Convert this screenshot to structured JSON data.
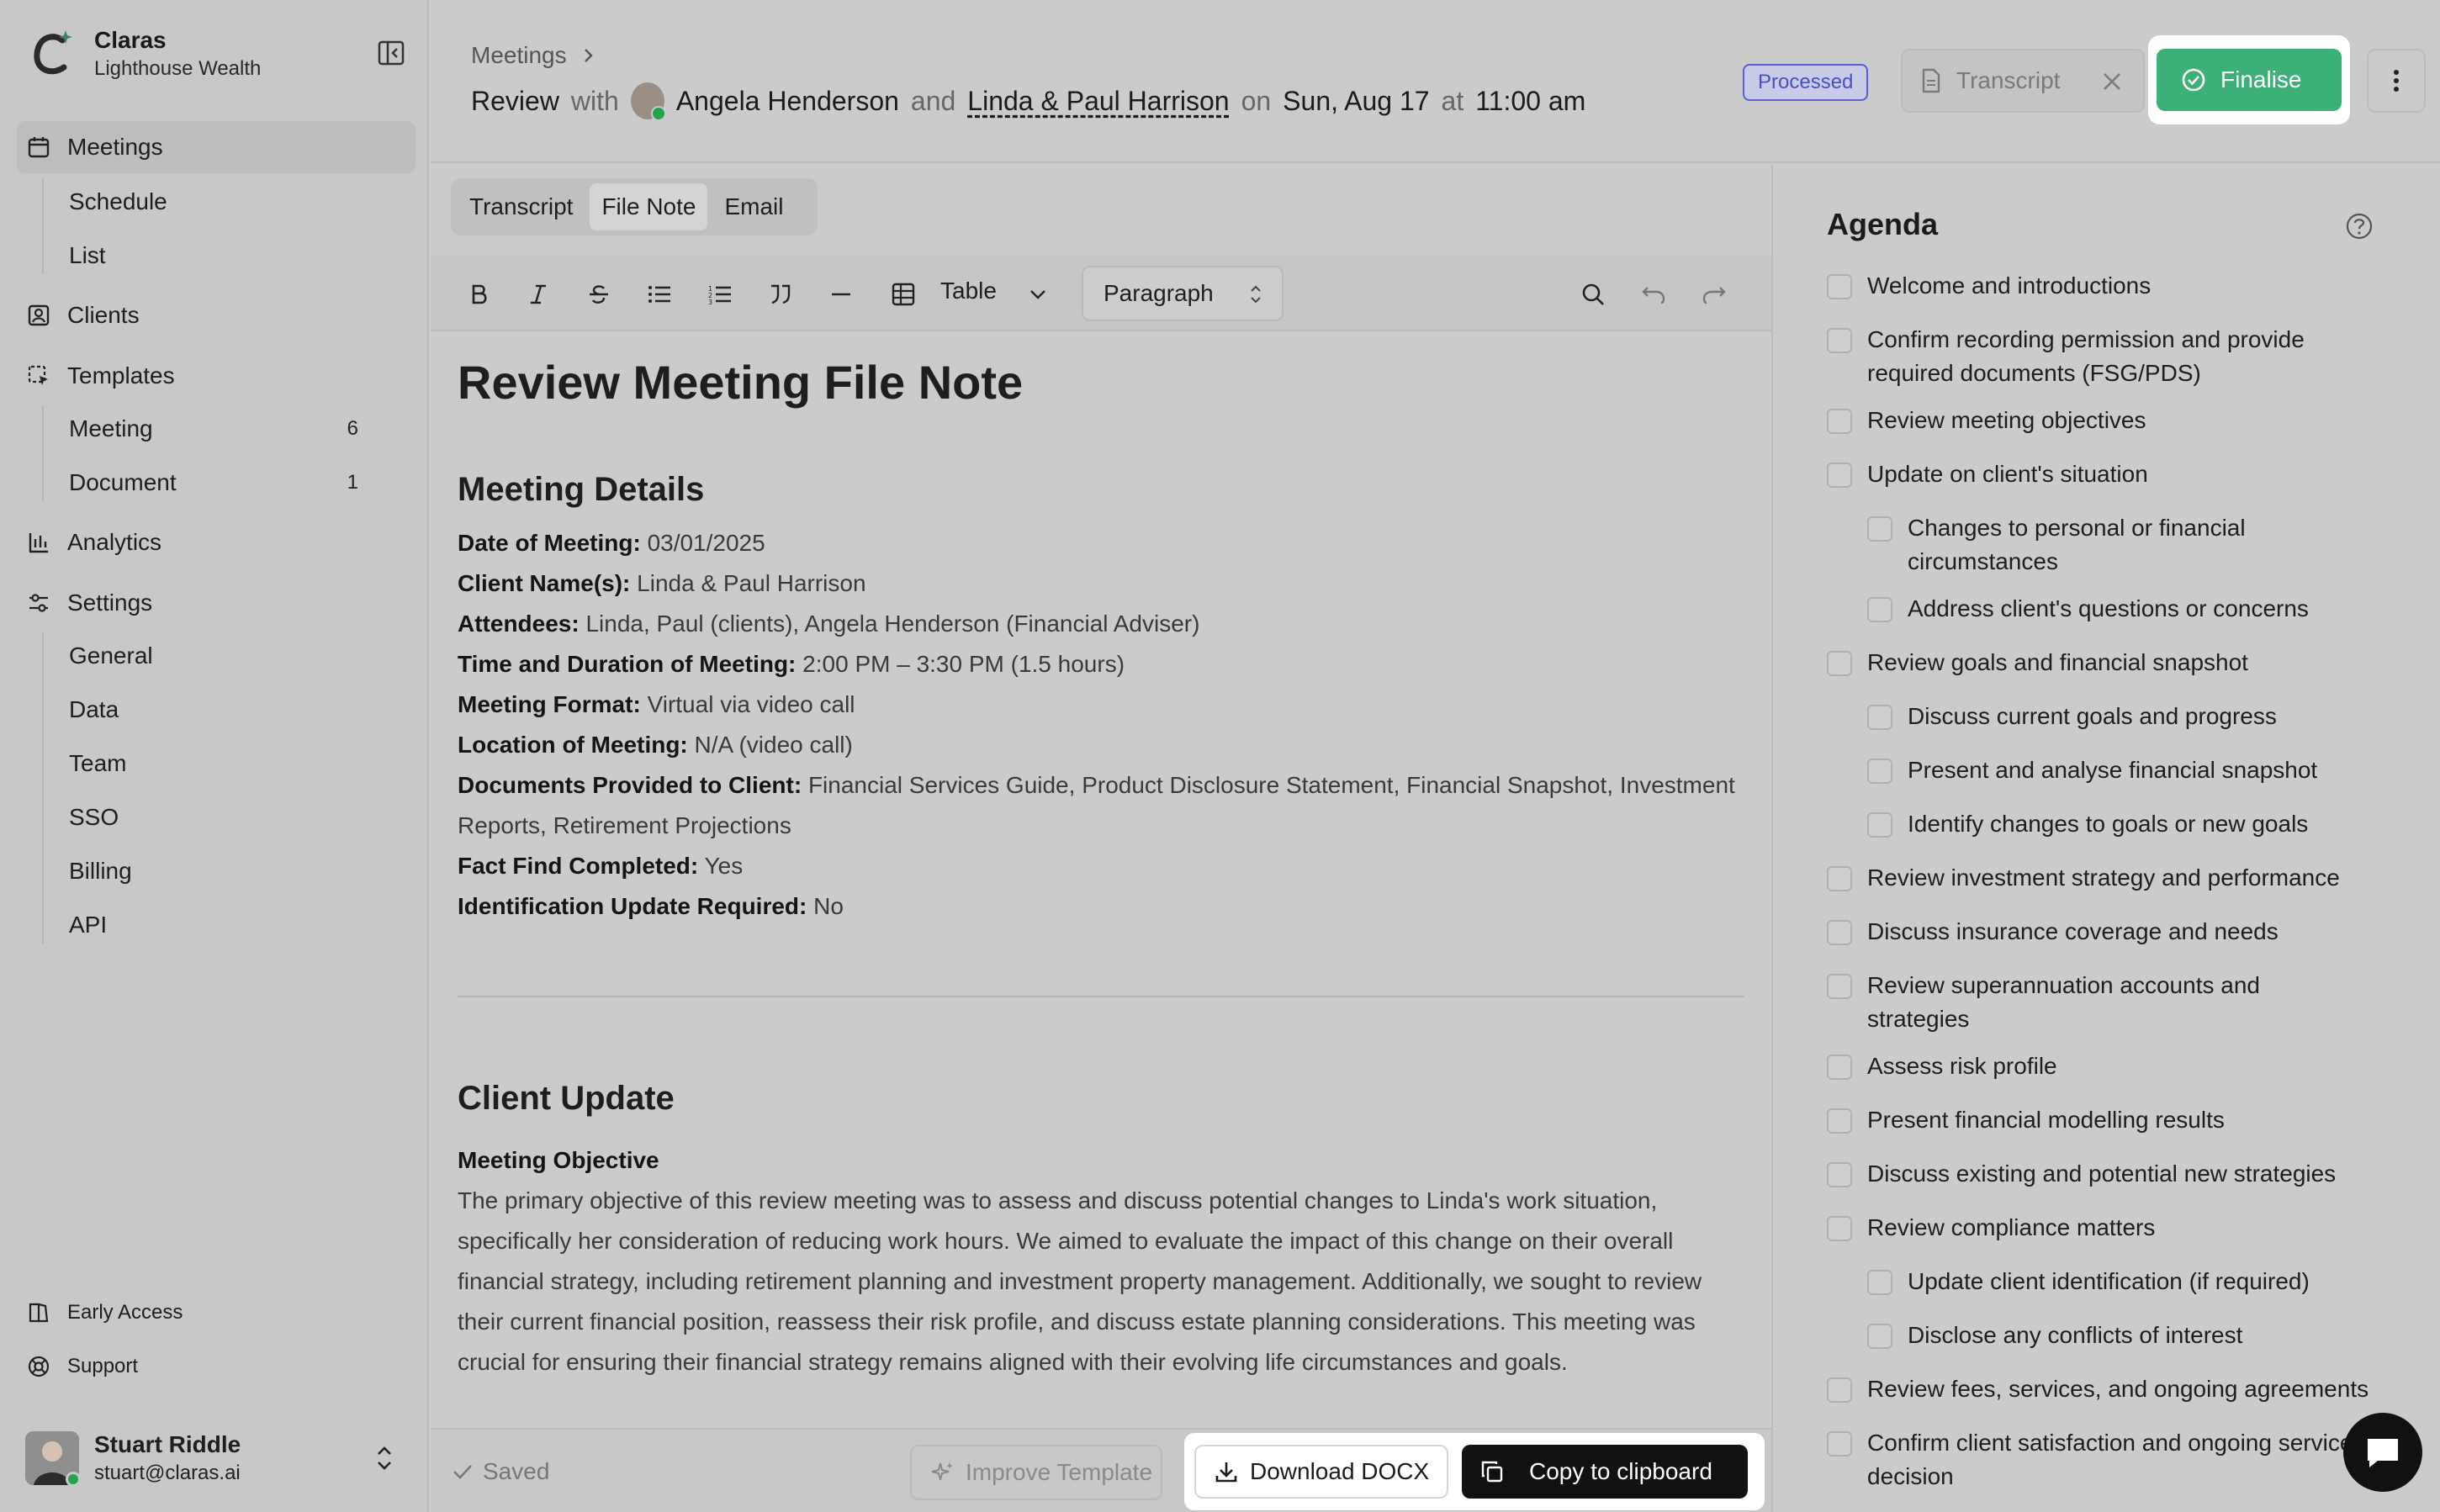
{
  "brand": {
    "name": "Claras",
    "org": "Lighthouse Wealth"
  },
  "nav": {
    "meetings": "Meetings",
    "schedule": "Schedule",
    "list": "List",
    "clients": "Clients",
    "templates": "Templates",
    "meeting": "Meeting",
    "meeting_count": "6",
    "document": "Document",
    "document_count": "1",
    "analytics": "Analytics",
    "settings": "Settings",
    "general": "General",
    "data": "Data",
    "team": "Team",
    "sso": "SSO",
    "billing": "Billing",
    "api": "API",
    "early_access": "Early Access",
    "support": "Support"
  },
  "user": {
    "name": "Stuart Riddle",
    "email": "stuart@claras.ai"
  },
  "header": {
    "breadcrumb": "Meetings",
    "review": "Review",
    "with": "with",
    "adviser": "Angela Henderson",
    "and": "and",
    "clients": "Linda & Paul Harrison",
    "on": "on",
    "date": "Sun, Aug 17",
    "at": "at",
    "time": "11:00 am",
    "status": "Processed",
    "transcript_chip": "Transcript",
    "finalise": "Finalise"
  },
  "tabs": [
    "Transcript",
    "File Note",
    "Email"
  ],
  "toolbar": {
    "table": "Table",
    "paragraph": "Paragraph"
  },
  "doc": {
    "title": "Review Meeting File Note",
    "section1": "Meeting Details",
    "details": [
      {
        "label": "Date of Meeting:",
        "value": "03/01/2025"
      },
      {
        "label": "Client Name(s):",
        "value": "Linda & Paul Harrison"
      },
      {
        "label": "Attendees:",
        "value": "Linda, Paul (clients), Angela Henderson (Financial Adviser)"
      },
      {
        "label": "Time and Duration of Meeting:",
        "value": "2:00 PM – 3:30 PM (1.5 hours)"
      },
      {
        "label": "Meeting Format:",
        "value": "Virtual via video call"
      },
      {
        "label": "Location of Meeting:",
        "value": "N/A (video call)"
      },
      {
        "label": "Documents Provided to Client:",
        "value": "Financial Services Guide, Product Disclosure Statement, Financial Snapshot, Investment Reports, Retirement Projections"
      },
      {
        "label": "Fact Find Completed:",
        "value": "Yes"
      },
      {
        "label": "Identification Update Required:",
        "value": "No"
      }
    ],
    "section2": "Client Update",
    "objective_title": "Meeting Objective",
    "objective_text": "The primary objective of this review meeting was to assess and discuss potential changes to Linda's work situation, specifically her consideration of reducing work hours. We aimed to evaluate the impact of this change on their overall financial strategy, including retirement planning and investment property management. Additionally, we sought to review their current financial position, reassess their risk profile, and discuss estate planning considerations. This meeting was crucial for ensuring their financial strategy remains aligned with their evolving life circumstances and goals."
  },
  "bottom": {
    "saved": "Saved",
    "improve": "Improve Template",
    "download": "Download DOCX",
    "copy": "Copy to clipboard"
  },
  "agenda": {
    "title": "Agenda",
    "items": [
      {
        "text": "Welcome and introductions",
        "sub": false
      },
      {
        "text": "Confirm recording permission and provide required documents (FSG/PDS)",
        "sub": false
      },
      {
        "text": "Review meeting objectives",
        "sub": false
      },
      {
        "text": "Update on client's situation",
        "sub": false
      },
      {
        "text": "Changes to personal or financial circumstances",
        "sub": true
      },
      {
        "text": "Address client's questions or concerns",
        "sub": true
      },
      {
        "text": "Review goals and financial snapshot",
        "sub": false
      },
      {
        "text": "Discuss current goals and progress",
        "sub": true
      },
      {
        "text": "Present and analyse financial snapshot",
        "sub": true
      },
      {
        "text": "Identify changes to goals or new goals",
        "sub": true
      },
      {
        "text": "Review investment strategy and performance",
        "sub": false
      },
      {
        "text": "Discuss insurance coverage and needs",
        "sub": false
      },
      {
        "text": "Review superannuation accounts and strategies",
        "sub": false
      },
      {
        "text": "Assess risk profile",
        "sub": false
      },
      {
        "text": "Present financial modelling results",
        "sub": false
      },
      {
        "text": "Discuss existing and potential new strategies",
        "sub": false
      },
      {
        "text": "Review compliance matters",
        "sub": false
      },
      {
        "text": "Update client identification (if required)",
        "sub": true
      },
      {
        "text": "Disclose any conflicts of interest",
        "sub": true
      },
      {
        "text": "Review fees, services, and ongoing agreements",
        "sub": false
      },
      {
        "text": "Confirm client satisfaction and ongoing service decision",
        "sub": false
      }
    ]
  }
}
